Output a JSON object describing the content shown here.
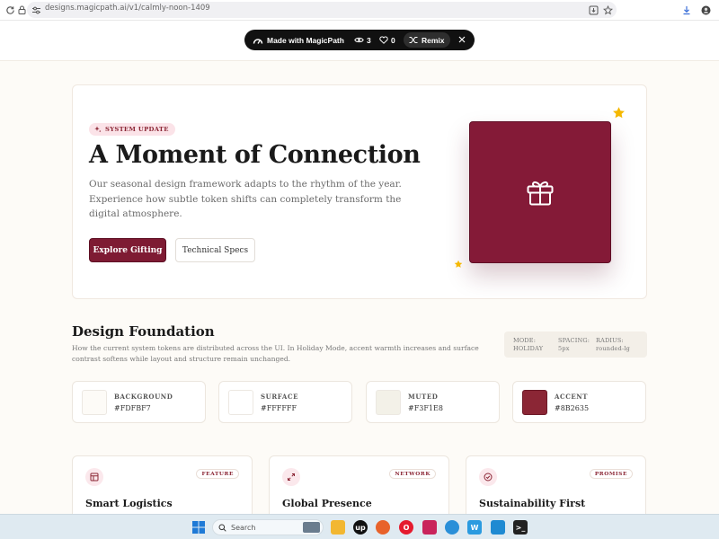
{
  "browser": {
    "url": "designs.magicpath.ai/v1/calmly-noon-1409"
  },
  "magicpath": {
    "label": "Made with MagicPath",
    "views": "3",
    "likes": "0",
    "remix_label": "Remix"
  },
  "hero": {
    "badge": "SYSTEM UPDATE",
    "title": "A Moment of Connection",
    "description": "Our seasonal design framework adapts to the rhythm of the year. Experience how subtle token shifts can completely transform the digital atmosphere.",
    "primary_button": "Explore Gifting",
    "secondary_button": "Technical Specs"
  },
  "foundation": {
    "title": "Design Foundation",
    "description": "How the current system tokens are distributed across the UI. In Holiday Mode, accent warmth increases and surface contrast softens while layout and structure remain unchanged.",
    "meta": [
      {
        "key": "MODE:",
        "value": "HOLIDAY"
      },
      {
        "key": "SPACING:",
        "value": "5px"
      },
      {
        "key": "RADIUS:",
        "value": "rounded-lg"
      }
    ],
    "tokens": [
      {
        "name": "BACKGROUND",
        "hex": "#FDFBF7",
        "color": "#FDFBF7"
      },
      {
        "name": "SURFACE",
        "hex": "#FFFFFF",
        "color": "#FFFFFF"
      },
      {
        "name": "MUTED",
        "hex": "#F3F1E8",
        "color": "#F3F1E8"
      },
      {
        "name": "ACCENT",
        "hex": "#8B2635",
        "color": "#8B2635"
      }
    ]
  },
  "features": [
    {
      "tag": "FEATURE",
      "title": "Smart Logistics",
      "icon": "layout-icon"
    },
    {
      "tag": "NETWORK",
      "title": "Global Presence",
      "icon": "expand-icon"
    },
    {
      "tag": "PROMISE",
      "title": "Sustainability First",
      "icon": "check-circle-icon"
    }
  ],
  "taskbar": {
    "search_placeholder": "Search"
  },
  "colors": {
    "accent": "#8B2635",
    "background": "#FDFBF7",
    "star": "#F5B800"
  }
}
